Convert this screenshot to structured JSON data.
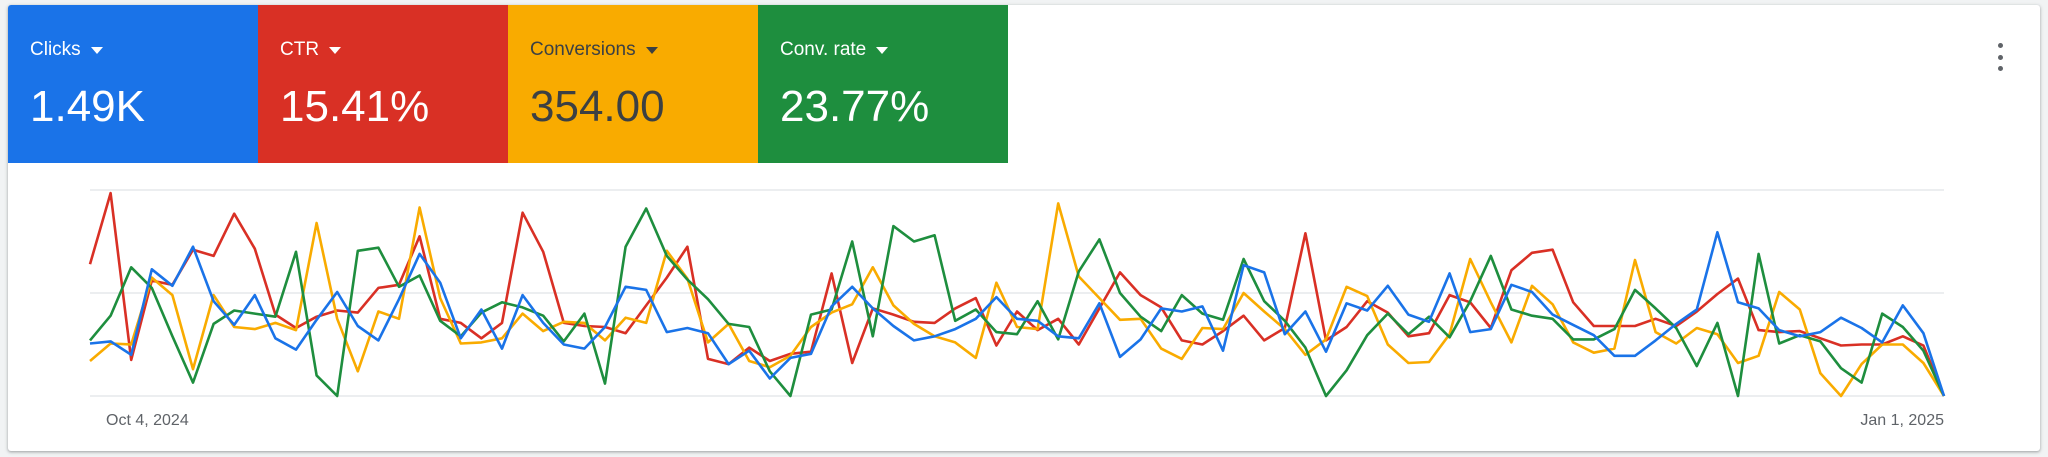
{
  "tiles": [
    {
      "label": "Clicks",
      "value": "1.49K",
      "bg": "#1a73e8",
      "fg": "#ffffff"
    },
    {
      "label": "CTR",
      "value": "15.41%",
      "bg": "#d93025",
      "fg": "#ffffff"
    },
    {
      "label": "Conversions",
      "value": "354.00",
      "bg": "#f9ab00",
      "fg": "#3c4043"
    },
    {
      "label": "Conv. rate",
      "value": "23.77%",
      "bg": "#1e8e3e",
      "fg": "#ffffff"
    }
  ],
  "menu_icon": "more-vert-icon",
  "chart_data": {
    "type": "line",
    "x_start": "Oct 4, 2024",
    "x_end": "Jan 1, 2025",
    "x_ticks": [
      "Oct 4, 2024",
      "Jan 1, 2025"
    ],
    "y_scale": "normalized per series (0 = bottom, 2 = top), no y tick labels",
    "ylim": [
      0,
      2
    ],
    "grid": true,
    "legend": "none",
    "series": [
      {
        "name": "CTR",
        "color": "#d93025",
        "values": [
          1.28,
          1.97,
          0.35,
          1.12,
          1.08,
          1.42,
          1.36,
          1.77,
          1.43,
          0.79,
          0.66,
          0.77,
          0.83,
          0.81,
          1.05,
          1.08,
          1.55,
          0.75,
          0.71,
          0.56,
          0.71,
          1.78,
          1.4,
          0.71,
          0.68,
          0.67,
          0.61,
          0.88,
          1.15,
          1.45,
          0.36,
          0.31,
          0.47,
          0.34,
          0.41,
          0.43,
          1.19,
          0.32,
          0.85,
          0.79,
          0.72,
          0.71,
          0.85,
          0.95,
          0.49,
          0.82,
          0.64,
          0.75,
          0.5,
          0.85,
          1.2,
          0.98,
          0.86,
          0.54,
          0.5,
          0.63,
          0.78,
          0.54,
          0.66,
          1.58,
          0.54,
          0.67,
          0.92,
          0.81,
          0.58,
          0.61,
          0.98,
          0.91,
          0.66,
          1.22,
          1.39,
          1.42,
          0.91,
          0.68,
          0.68,
          0.68,
          0.75,
          0.68,
          0.82,
          0.99,
          1.14,
          0.64,
          0.62,
          0.63,
          0.56,
          0.49,
          0.5,
          0.5,
          0.58,
          0.49,
          0.0
        ]
      },
      {
        "name": "Conversions",
        "color": "#f9ab00",
        "values": [
          0.34,
          0.51,
          0.5,
          1.15,
          0.98,
          0.26,
          0.98,
          0.67,
          0.65,
          0.71,
          0.64,
          1.68,
          0.75,
          0.24,
          0.82,
          0.75,
          1.83,
          0.95,
          0.51,
          0.52,
          0.56,
          0.8,
          0.63,
          0.72,
          0.71,
          0.54,
          0.76,
          0.71,
          1.41,
          1.14,
          0.52,
          0.7,
          0.34,
          0.28,
          0.39,
          0.67,
          0.81,
          0.89,
          1.25,
          0.88,
          0.7,
          0.58,
          0.52,
          0.37,
          1.1,
          0.67,
          0.65,
          1.87,
          1.16,
          0.95,
          0.74,
          0.75,
          0.46,
          0.36,
          0.66,
          0.65,
          1.0,
          0.82,
          0.65,
          0.4,
          0.55,
          1.06,
          0.97,
          0.5,
          0.32,
          0.33,
          0.6,
          1.33,
          0.91,
          0.52,
          1.07,
          0.89,
          0.52,
          0.42,
          0.46,
          1.32,
          0.62,
          0.51,
          0.66,
          0.6,
          0.32,
          0.39,
          1.01,
          0.84,
          0.22,
          0.0,
          0.31,
          0.5,
          0.5,
          0.32,
          0.0
        ]
      },
      {
        "name": "Conv. rate",
        "color": "#1e8e3e",
        "values": [
          0.54,
          0.78,
          1.25,
          1.05,
          0.58,
          0.13,
          0.7,
          0.83,
          0.8,
          0.77,
          1.4,
          0.2,
          0.0,
          1.41,
          1.44,
          1.06,
          1.17,
          0.73,
          0.58,
          0.81,
          0.91,
          0.86,
          0.78,
          0.53,
          0.8,
          0.12,
          1.45,
          1.82,
          1.36,
          1.13,
          0.94,
          0.7,
          0.67,
          0.24,
          0.0,
          0.79,
          0.84,
          1.5,
          0.58,
          1.65,
          1.5,
          1.56,
          0.73,
          0.84,
          0.62,
          0.6,
          0.92,
          0.55,
          1.21,
          1.52,
          1.0,
          0.77,
          0.63,
          0.98,
          0.8,
          0.74,
          1.33,
          0.92,
          0.73,
          0.47,
          0.0,
          0.25,
          0.59,
          0.8,
          0.6,
          0.77,
          0.57,
          0.92,
          1.36,
          0.84,
          0.78,
          0.75,
          0.55,
          0.55,
          0.65,
          1.03,
          0.85,
          0.66,
          0.29,
          0.71,
          0.0,
          1.38,
          0.51,
          0.59,
          0.53,
          0.27,
          0.13,
          0.8,
          0.67,
          0.44,
          0.0
        ]
      },
      {
        "name": "Clicks",
        "color": "#1a73e8",
        "values": [
          0.51,
          0.53,
          0.4,
          1.23,
          1.07,
          1.45,
          0.92,
          0.69,
          0.98,
          0.56,
          0.45,
          0.74,
          1.01,
          0.68,
          0.54,
          0.94,
          1.38,
          1.1,
          0.56,
          0.84,
          0.46,
          0.98,
          0.71,
          0.5,
          0.46,
          0.67,
          1.06,
          1.03,
          0.62,
          0.66,
          0.61,
          0.31,
          0.44,
          0.17,
          0.37,
          0.41,
          0.87,
          1.06,
          0.85,
          0.68,
          0.54,
          0.58,
          0.65,
          0.75,
          0.96,
          0.75,
          0.73,
          0.58,
          0.56,
          0.9,
          0.38,
          0.55,
          0.85,
          0.82,
          0.87,
          0.44,
          1.27,
          1.2,
          0.6,
          0.82,
          0.43,
          0.9,
          0.83,
          1.07,
          0.79,
          0.72,
          1.19,
          0.62,
          0.65,
          1.08,
          1.01,
          0.79,
          0.69,
          0.59,
          0.39,
          0.39,
          0.54,
          0.7,
          0.84,
          1.59,
          0.91,
          0.85,
          0.64,
          0.58,
          0.62,
          0.76,
          0.66,
          0.52,
          0.88,
          0.61,
          0.0
        ]
      }
    ]
  }
}
